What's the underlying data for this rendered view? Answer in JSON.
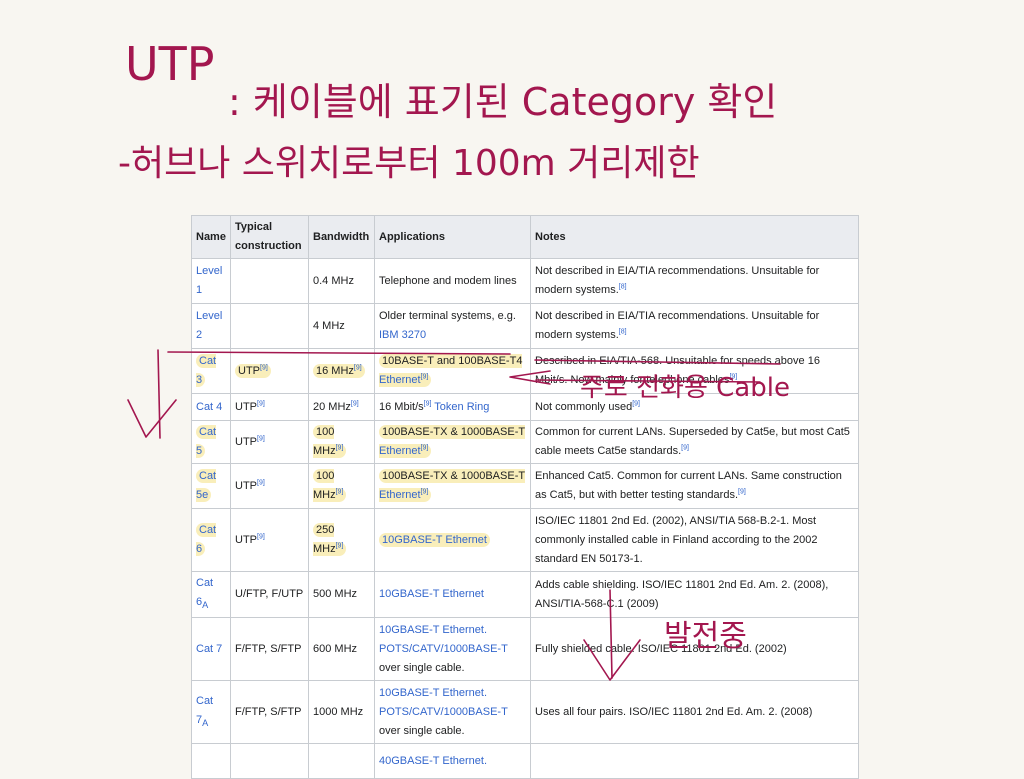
{
  "handwriting": {
    "title": "UTP",
    "line1": ": 케이블에 표기된 Category 확인",
    "line2": "-허브나 스위치로부터 100m 거리제한",
    "arrow_note": "주로 전화용 Cable",
    "development": "발전중"
  },
  "table": {
    "headers": {
      "name": "Name",
      "construction": "Typical construction",
      "bandwidth": "Bandwidth",
      "applications": "Applications",
      "notes": "Notes"
    },
    "rows": [
      {
        "name": "Level 1",
        "construction": "",
        "bandwidth": "0.4 MHz",
        "applications": "Telephone and modem lines",
        "notes": "Not described in EIA/TIA recommendations. Unsuitable for modern systems.",
        "notes_ref": "[8]"
      },
      {
        "name": "Level 2",
        "construction": "",
        "bandwidth": "4 MHz",
        "applications_prefix": "Older terminal systems, e.g. ",
        "applications_link": "IBM 3270",
        "notes": "Not described in EIA/TIA recommendations. Unsuitable for modern systems.",
        "notes_ref": "[8]"
      },
      {
        "name": "Cat 3",
        "construction": "UTP",
        "construction_ref": "[9]",
        "bandwidth": "16 MHz",
        "bandwidth_ref": "[9]",
        "applications_prefix": "10BASE-T and 100BASE-T4 ",
        "applications_link": "Ethernet",
        "applications_ref": "[9]",
        "notes": "Described in EIA/TIA-568. Unsuitable for speeds above 16 Mbit/s. Now mainly for telephone cables",
        "notes_ref": "[9]"
      },
      {
        "name": "Cat 4",
        "construction": "UTP",
        "construction_ref": "[9]",
        "bandwidth": "20 MHz",
        "bandwidth_ref": "[9]",
        "applications_prefix": "16 Mbit/s",
        "applications_mid_ref": "[9]",
        "applications_link": "Token Ring",
        "notes": "Not commonly used",
        "notes_ref": "[9]"
      },
      {
        "name": "Cat 5",
        "construction": "UTP",
        "construction_ref": "[9]",
        "bandwidth": "100 MHz",
        "bandwidth_ref": "[9]",
        "applications_prefix": "100BASE-TX & 1000BASE-T ",
        "applications_link": "Ethernet",
        "applications_ref": "[9]",
        "notes": "Common for current LANs. Superseded by Cat5e, but most Cat5 cable meets Cat5e standards.",
        "notes_ref": "[9]"
      },
      {
        "name": "Cat 5e",
        "construction": "UTP",
        "construction_ref": "[9]",
        "bandwidth": "100 MHz",
        "bandwidth_ref": "[9]",
        "applications_prefix": "100BASE-TX & 1000BASE-T ",
        "applications_link": "Ethernet",
        "applications_ref": "[9]",
        "notes": "Enhanced Cat5. Common for current LANs. Same construction as Cat5, but with better testing standards.",
        "notes_ref": "[9]"
      },
      {
        "name": "Cat 6",
        "construction": "UTP",
        "construction_ref": "[9]",
        "bandwidth": "250 MHz",
        "bandwidth_ref": "[9]",
        "applications_link": "10GBASE-T Ethernet",
        "notes": "ISO/IEC 11801 2nd Ed. (2002), ANSI/TIA 568-B.2-1. Most commonly installed cable in Finland according to the 2002 standard EN 50173-1."
      },
      {
        "name_main": "Cat 6",
        "name_sub": "A",
        "construction": "U/FTP, F/UTP",
        "bandwidth": "500 MHz",
        "applications_link": "10GBASE-T Ethernet",
        "notes": "Adds cable shielding. ISO/IEC 11801 2nd Ed. Am. 2. (2008), ANSI/TIA-568-C.1 (2009)"
      },
      {
        "name": "Cat 7",
        "construction": "F/FTP, S/FTP",
        "bandwidth": "600 MHz",
        "applications_link": "10GBASE-T Ethernet. POTS/CATV/1000BASE-T",
        "applications_suffix": " over single cable.",
        "notes": "Fully shielded cable. ISO/IEC 11801 2nd Ed. (2002)"
      },
      {
        "name_main": "Cat 7",
        "name_sub": "A",
        "construction": "F/FTP, S/FTP",
        "bandwidth": "1000 MHz",
        "applications_link": "10GBASE-T Ethernet. POTS/CATV/1000BASE-T",
        "applications_suffix": " over single cable.",
        "notes": "Uses all four pairs. ISO/IEC 11801 2nd Ed. Am. 2. (2008)"
      },
      {
        "applications_link": "40GBASE-T Ethernet."
      }
    ]
  },
  "colors": {
    "ink": "#a3174f",
    "highlight": "#f6e8a0",
    "link": "#3366cc",
    "header_bg": "#eaecf0",
    "border": "#c8ccd1",
    "paper": "#f8f6f1"
  }
}
